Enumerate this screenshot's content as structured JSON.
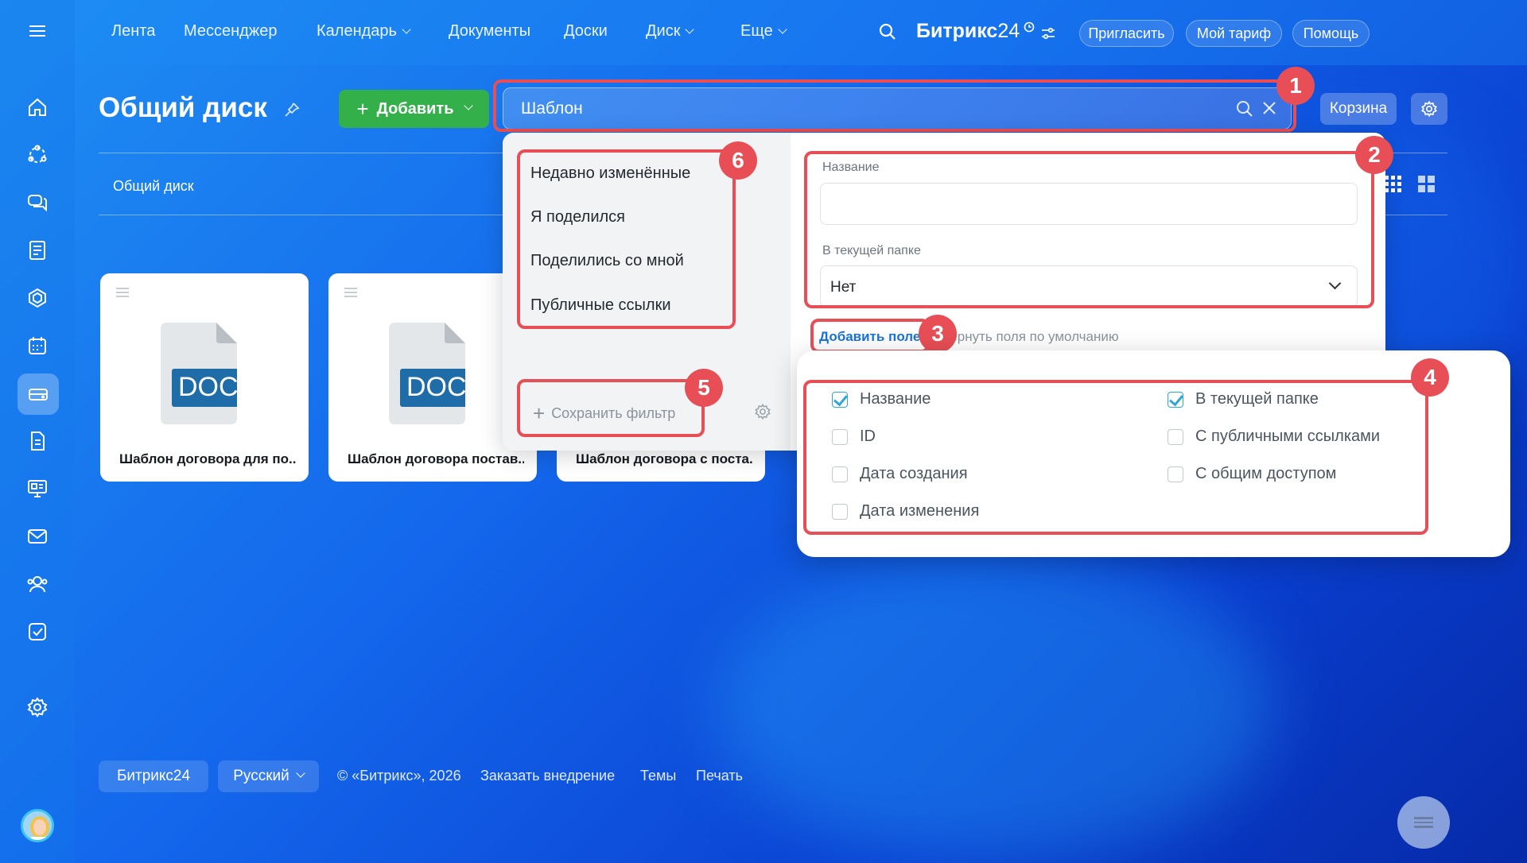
{
  "top_nav": {
    "items": [
      {
        "label": "Лента"
      },
      {
        "label": "Мессенджер"
      },
      {
        "label": "Календарь"
      },
      {
        "label": "Документы"
      },
      {
        "label": "Доски"
      },
      {
        "label": "Диск"
      },
      {
        "label": "Еще"
      }
    ],
    "brand": "Битрикс",
    "brand_num": "24",
    "invite": "Пригласить",
    "tariff": "Мой тариф",
    "help": "Помощь"
  },
  "page": {
    "title": "Общий диск",
    "add_button": "Добавить",
    "search_value": "Шаблон",
    "trash_button": "Корзина",
    "breadcrumb": "Общий диск"
  },
  "files": [
    {
      "name": "Шаблон договора для по...",
      "type": "DOC"
    },
    {
      "name": "Шаблон договора постав...",
      "type": "DOC"
    },
    {
      "name": "Шаблон договора с поста...",
      "type": "DOC"
    }
  ],
  "filter": {
    "presets": [
      "Недавно изменённые",
      "Я поделился",
      "Поделились со мной",
      "Публичные ссылки"
    ],
    "save_filter": "Сохранить фильтр",
    "name_label": "Название",
    "name_value": "",
    "folder_label": "В текущей папке",
    "folder_value": "Нет",
    "add_field": "Добавить поле",
    "reset_fields": "Вернуть поля по умолчанию"
  },
  "fields_popup": {
    "options": [
      {
        "label": "Название",
        "checked": true
      },
      {
        "label": "В текущей папке",
        "checked": true
      },
      {
        "label": "ID",
        "checked": false
      },
      {
        "label": "С публичными ссылками",
        "checked": false
      },
      {
        "label": "Дата создания",
        "checked": false
      },
      {
        "label": "С общим доступом",
        "checked": false
      },
      {
        "label": "Дата изменения",
        "checked": false
      }
    ]
  },
  "badges": [
    "1",
    "2",
    "3",
    "4",
    "5",
    "6"
  ],
  "footer": {
    "brand": "Битрикс24",
    "language": "Русский",
    "copyright": "© «Битрикс», 2026",
    "order": "Заказать внедрение",
    "themes": "Темы",
    "print": "Печать"
  },
  "sidebar_icons": [
    "menu-icon",
    "home-icon",
    "crm-icon",
    "chat-icon",
    "news-icon",
    "hexagon-icon",
    "calendar-icon",
    "drive-icon",
    "document-icon",
    "presentation-icon",
    "mail-icon",
    "team-icon",
    "tasks-icon",
    "settings-icon"
  ],
  "colors": {
    "accent_green": "#34b04a",
    "highlight_red": "#e84e55",
    "checkbox_blue": "#2fa6d6"
  }
}
